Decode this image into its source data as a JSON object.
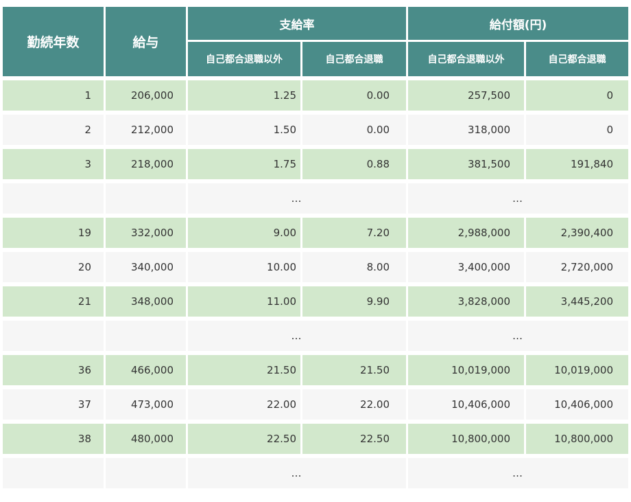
{
  "header": {
    "years": "勤続年数",
    "salary": "給与",
    "rate_group": "支給率",
    "amount_group": "給付額(円)",
    "rate_voluntary_excluded": "自己都合退職以外",
    "rate_voluntary": "自己都合退職",
    "amount_voluntary_excluded": "自己都合退職以外",
    "amount_voluntary": "自己都合退職"
  },
  "colors": {
    "header_bg": "#4a8c89",
    "row_green": "#d2e8cc",
    "row_gray": "#f6f6f6"
  },
  "rows": [
    {
      "type": "data",
      "style": "green",
      "years": "1",
      "salary": "206,000",
      "rate_other": "1.25",
      "rate_self": "0.00",
      "amount_other": "257,500",
      "amount_self": "0"
    },
    {
      "type": "data",
      "style": "gray",
      "years": "2",
      "salary": "212,000",
      "rate_other": "1.50",
      "rate_self": "0.00",
      "amount_other": "318,000",
      "amount_self": "0"
    },
    {
      "type": "data",
      "style": "green",
      "years": "3",
      "salary": "218,000",
      "rate_other": "1.75",
      "rate_self": "0.88",
      "amount_other": "381,500",
      "amount_self": "191,840"
    },
    {
      "type": "ellipsis",
      "style": "gray",
      "rate_mark": "…",
      "amount_mark": "…"
    },
    {
      "type": "data",
      "style": "green",
      "years": "19",
      "salary": "332,000",
      "rate_other": "9.00",
      "rate_self": "7.20",
      "amount_other": "2,988,000",
      "amount_self": "2,390,400"
    },
    {
      "type": "data",
      "style": "gray",
      "years": "20",
      "salary": "340,000",
      "rate_other": "10.00",
      "rate_self": "8.00",
      "amount_other": "3,400,000",
      "amount_self": "2,720,000"
    },
    {
      "type": "data",
      "style": "green",
      "years": "21",
      "salary": "348,000",
      "rate_other": "11.00",
      "rate_self": "9.90",
      "amount_other": "3,828,000",
      "amount_self": "3,445,200"
    },
    {
      "type": "ellipsis",
      "style": "gray",
      "rate_mark": "…",
      "amount_mark": "…"
    },
    {
      "type": "data",
      "style": "green",
      "years": "36",
      "salary": "466,000",
      "rate_other": "21.50",
      "rate_self": "21.50",
      "amount_other": "10,019,000",
      "amount_self": "10,019,000"
    },
    {
      "type": "data",
      "style": "gray",
      "years": "37",
      "salary": "473,000",
      "rate_other": "22.00",
      "rate_self": "22.00",
      "amount_other": "10,406,000",
      "amount_self": "10,406,000"
    },
    {
      "type": "data",
      "style": "green",
      "years": "38",
      "salary": "480,000",
      "rate_other": "22.50",
      "rate_self": "22.50",
      "amount_other": "10,800,000",
      "amount_self": "10,800,000"
    },
    {
      "type": "ellipsis",
      "style": "gray",
      "rate_mark": "…",
      "amount_mark": "…"
    }
  ]
}
